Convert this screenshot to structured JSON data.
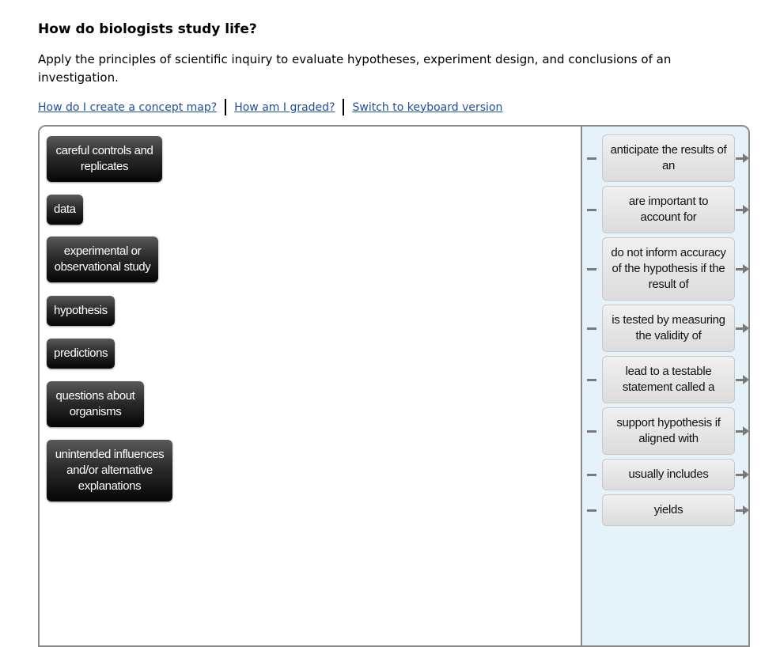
{
  "header": {
    "title": "How do biologists study life?",
    "description": "Apply the principles of scientific inquiry to evaluate hypotheses, experiment design, and conclusions of an investigation."
  },
  "help_links": [
    {
      "label": "How do I create a concept map?"
    },
    {
      "label": "How am I graded?"
    },
    {
      "label": "Switch to keyboard version"
    }
  ],
  "terms": [
    {
      "label": "careful controls and replicates"
    },
    {
      "label": "data"
    },
    {
      "label": "experimental or observational study"
    },
    {
      "label": "hypothesis"
    },
    {
      "label": "predictions"
    },
    {
      "label": "questions about organisms"
    },
    {
      "label": "unintended influences and/or alternative explanations"
    }
  ],
  "linking_phrases": [
    {
      "label": "anticipate the results of an"
    },
    {
      "label": "are important to account for"
    },
    {
      "label": "do not inform accuracy of the hypothesis if the result of"
    },
    {
      "label": "is tested by measuring the validity of"
    },
    {
      "label": "lead to a testable statement called a"
    },
    {
      "label": "support hypothesis if aligned with"
    },
    {
      "label": "usually includes"
    },
    {
      "label": "yields"
    }
  ]
}
